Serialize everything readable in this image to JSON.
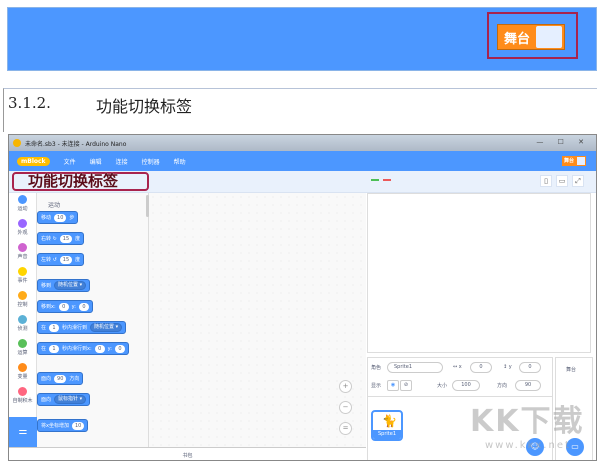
{
  "banner": {
    "stage_toggle_label": "舞台"
  },
  "heading": {
    "number": "3.1.2.",
    "title": "功能切换标签"
  },
  "window": {
    "title": "未命名.sb3 - 未连接 - Arduino Nano",
    "window_controls": "— ☐ ✕",
    "logo": "mBlock",
    "menu": [
      "文件",
      "编辑",
      "连接",
      "控制器",
      "帮助"
    ],
    "stage_toggle_label": "舞台",
    "tab_callout": "功能切换标签",
    "categories": [
      {
        "label": "运动",
        "color": "#4c97ff"
      },
      {
        "label": "外观",
        "color": "#9966ff"
      },
      {
        "label": "声音",
        "color": "#cf63cf"
      },
      {
        "label": "事件",
        "color": "#ffd500"
      },
      {
        "label": "控制",
        "color": "#ffab19"
      },
      {
        "label": "侦测",
        "color": "#5cb1d6"
      },
      {
        "label": "运算",
        "color": "#59c059"
      },
      {
        "label": "变量",
        "color": "#ff8c1a"
      },
      {
        "label": "自制积木",
        "color": "#ff6680"
      }
    ],
    "palette_heading": "运动",
    "blocks": [
      [
        {
          "t": "移动"
        },
        {
          "v": "10"
        },
        {
          "t": "步"
        }
      ],
      [
        {
          "t": "右转 ↻"
        },
        {
          "v": "15"
        },
        {
          "t": "度"
        }
      ],
      [
        {
          "t": "左转 ↺"
        },
        {
          "v": "15"
        },
        {
          "t": "度"
        }
      ],
      [
        {
          "t": "移到"
        },
        {
          "d": "随机位置 ▾"
        }
      ],
      [
        {
          "t": "移到x:"
        },
        {
          "v": "0"
        },
        {
          "t": "y:"
        },
        {
          "v": "0"
        }
      ],
      [
        {
          "t": "在"
        },
        {
          "v": "1"
        },
        {
          "t": "秒内滑行到"
        },
        {
          "d": "随机位置 ▾"
        }
      ],
      [
        {
          "t": "在"
        },
        {
          "v": "1"
        },
        {
          "t": "秒内滑行到x:"
        },
        {
          "v": "0"
        },
        {
          "t": "y:"
        },
        {
          "v": "0"
        }
      ],
      [
        {
          "t": "面向"
        },
        {
          "v": "90"
        },
        {
          "t": "方向"
        }
      ],
      [
        {
          "t": "面向"
        },
        {
          "d": "鼠标指针 ▾"
        }
      ],
      [
        {
          "t": "将x坐标增加"
        },
        {
          "v": "10"
        }
      ]
    ],
    "zoom_in": "+",
    "zoom_out": "−",
    "zoom_reset": "=",
    "backpack": "书包",
    "sprite": {
      "label": "角色",
      "name": "Sprite1",
      "x_label": "↔ x",
      "x": "0",
      "y_label": "↕ y",
      "y": "0",
      "show_label": "显示",
      "size_label": "大小",
      "size": "100",
      "direction_label": "方向",
      "direction": "90"
    },
    "sprite_thumb_name": "Sprite1",
    "stage_pane_label": "舞台"
  },
  "watermark": {
    "text": "KK下载",
    "url": "www.kkx.net"
  }
}
